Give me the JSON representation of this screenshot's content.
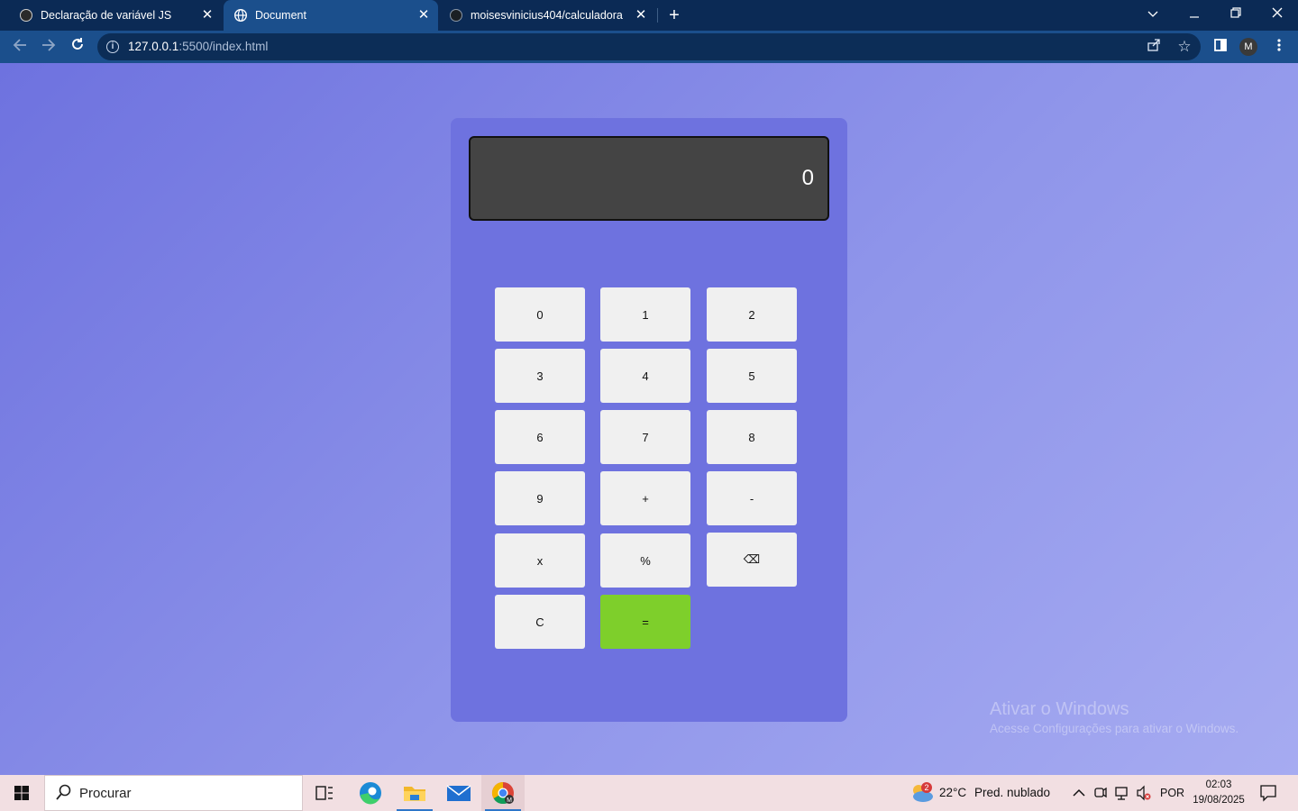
{
  "browser": {
    "tabs": [
      {
        "title": "Declaração de variável JS",
        "active": false,
        "favicon": "openai-icon"
      },
      {
        "title": "Document",
        "active": true,
        "favicon": "globe-icon"
      },
      {
        "title": "moisesvinicius404/calculadora",
        "active": false,
        "favicon": "github-icon"
      }
    ],
    "close_glyph": "✕",
    "new_tab_glyph": "+",
    "url_host": "127.0.0.1",
    "url_rest": ":5500/index.html",
    "profile_initial": "M"
  },
  "calculator": {
    "display": "0",
    "keys": [
      "0",
      "1",
      "2",
      "3",
      "4",
      "5",
      "6",
      "7",
      "8",
      "9",
      "+",
      "-",
      "x",
      "%",
      "⌫",
      "C",
      "="
    ],
    "equals_color": "#7ecf2b"
  },
  "watermark": {
    "line1": "Ativar o Windows",
    "line2": "Acesse Configurações para ativar o Windows."
  },
  "taskbar": {
    "search_placeholder": "Procurar",
    "weather_badge": "2",
    "temperature": "22°C",
    "weather_desc": "Pred. nublado",
    "language": "POR",
    "time": "02:03",
    "date": "19/08/2025"
  }
}
